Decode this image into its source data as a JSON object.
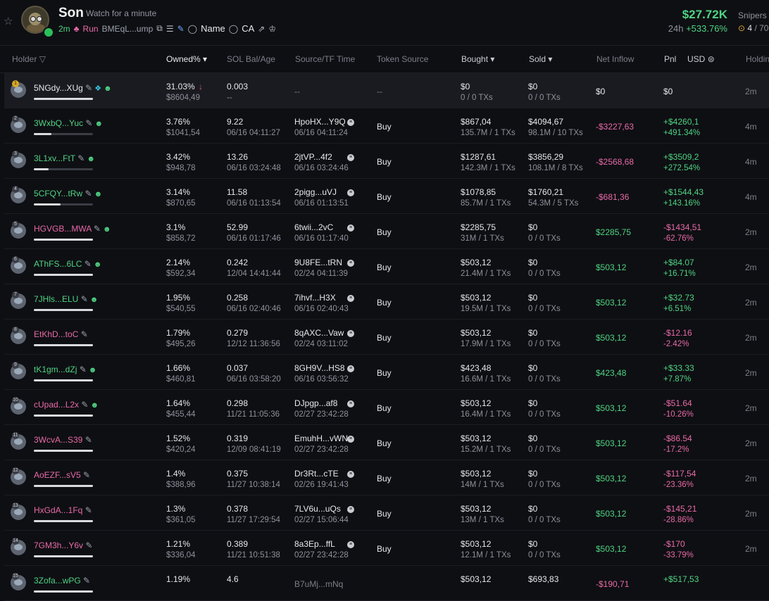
{
  "header": {
    "star_icon": "star-icon",
    "token_name": "Son",
    "token_subtitle": "Watch for a minute",
    "age": "2m",
    "platform": "Run",
    "contract_short": "BMEqL...ump",
    "search_name_label": "Name",
    "search_ca_label": "CA",
    "market_cap": "$27.72K",
    "change_period": "24h",
    "change_value": "+533.76%",
    "snipers_label": "Snipers",
    "snipers_value": "4",
    "snipers_total": "/ 70"
  },
  "columns": {
    "holder": "Holder",
    "owned": "Owned%",
    "sol_bal": "SOL Bal/Age",
    "source_tf": "Source/TF Time",
    "token_source": "Token Source",
    "bought": "Bought",
    "sold": "Sold",
    "net_inflow": "Net Inflow",
    "pnl": "Pnl",
    "usd": "USD",
    "holding": "Holdin"
  },
  "rows": [
    {
      "rank": "1",
      "addr": "5NGdy...XUg",
      "addr_color": "w",
      "bar": 1.0,
      "owned": "31.03%",
      "owned_usd": "$8604,49",
      "sol": "0.003",
      "sol_age": "--",
      "src": "--",
      "src_time": "",
      "token_source": "--",
      "bought": "$0",
      "bought_tx": "0 / 0 TXs",
      "sold": "$0",
      "sold_tx": "0 / 0 TXs",
      "inflow": "$0",
      "inflow_cls": "w",
      "pnl": "$0",
      "pnl_pct": "",
      "pnl_cls": "w",
      "holding": "2m"
    },
    {
      "rank": "2",
      "addr": "3WxbQ...Yuc",
      "addr_color": "g",
      "bar": 0.3,
      "owned": "3.76%",
      "owned_usd": "$1041,54",
      "sol": "9.22",
      "sol_age": "06/16 04:11:27",
      "src": "HpoHX...Y9Q",
      "src_time": "06/16 04:11:24",
      "token_source": "Buy",
      "bought": "$867,04",
      "bought_tx": "135.7M / 1 TXs",
      "sold": "$4094,67",
      "sold_tx": "98.1M / 10 TXs",
      "inflow": "-$3227,63",
      "inflow_cls": "neg",
      "pnl": "+$4260,1",
      "pnl_pct": "+491.34%",
      "pnl_cls": "pos",
      "holding": "4m"
    },
    {
      "rank": "3",
      "addr": "3L1xv...FtT",
      "addr_color": "g",
      "bar": 0.25,
      "owned": "3.42%",
      "owned_usd": "$948,78",
      "sol": "13.26",
      "sol_age": "06/16 03:24:48",
      "src": "2jtVP...4f2",
      "src_time": "06/16 03:24:46",
      "token_source": "Buy",
      "bought": "$1287,61",
      "bought_tx": "142.3M / 1 TXs",
      "sold": "$3856,29",
      "sold_tx": "108.1M / 8 TXs",
      "inflow": "-$2568,68",
      "inflow_cls": "neg",
      "pnl": "+$3509,2",
      "pnl_pct": "+272.54%",
      "pnl_cls": "pos",
      "holding": "4m"
    },
    {
      "rank": "4",
      "addr": "5CFQY...tRw",
      "addr_color": "g",
      "bar": 0.45,
      "owned": "3.14%",
      "owned_usd": "$870,65",
      "sol": "11.58",
      "sol_age": "06/16 01:13:54",
      "src": "2pigg...uVJ",
      "src_time": "06/16 01:13:51",
      "token_source": "Buy",
      "bought": "$1078,85",
      "bought_tx": "85.7M / 1 TXs",
      "sold": "$1760,21",
      "sold_tx": "54.3M / 5 TXs",
      "inflow": "-$681,36",
      "inflow_cls": "neg",
      "pnl": "+$1544,43",
      "pnl_pct": "+143.16%",
      "pnl_cls": "pos",
      "holding": "4m"
    },
    {
      "rank": "5",
      "addr": "HGVGB...MWA",
      "addr_color": "p",
      "bar": 1.0,
      "owned": "3.1%",
      "owned_usd": "$858,72",
      "sol": "52.99",
      "sol_age": "06/16 01:17:46",
      "src": "6twii...2vC",
      "src_time": "06/16 01:17:40",
      "token_source": "Buy",
      "bought": "$2285,75",
      "bought_tx": "31M / 1 TXs",
      "sold": "$0",
      "sold_tx": "0 / 0 TXs",
      "inflow": "$2285,75",
      "inflow_cls": "pos",
      "pnl": "-$1434,51",
      "pnl_pct": "-62.76%",
      "pnl_cls": "neg",
      "holding": "2m"
    },
    {
      "rank": "6",
      "addr": "AThFS...6LC",
      "addr_color": "g",
      "bar": 1.0,
      "owned": "2.14%",
      "owned_usd": "$592,34",
      "sol": "0.242",
      "sol_age": "12/04 14:41:44",
      "src": "9U8FE...tRN",
      "src_time": "02/24 04:11:39",
      "token_source": "Buy",
      "bought": "$503,12",
      "bought_tx": "21.4M / 1 TXs",
      "sold": "$0",
      "sold_tx": "0 / 0 TXs",
      "inflow": "$503,12",
      "inflow_cls": "pos",
      "pnl": "+$84.07",
      "pnl_pct": "+16.71%",
      "pnl_cls": "pos",
      "holding": "2m"
    },
    {
      "rank": "7",
      "addr": "7JHls...ELU",
      "addr_color": "g",
      "bar": 1.0,
      "owned": "1.95%",
      "owned_usd": "$540,55",
      "sol": "0.258",
      "sol_age": "06/16 02:40:46",
      "src": "7ihvf...H3X",
      "src_time": "06/16 02:40:43",
      "token_source": "Buy",
      "bought": "$503,12",
      "bought_tx": "19.5M / 1 TXs",
      "sold": "$0",
      "sold_tx": "0 / 0 TXs",
      "inflow": "$503,12",
      "inflow_cls": "pos",
      "pnl": "+$32.73",
      "pnl_pct": "+6.51%",
      "pnl_cls": "pos",
      "holding": "2m"
    },
    {
      "rank": "8",
      "addr": "EtKhD...toC",
      "addr_color": "p",
      "bar": 1.0,
      "owned": "1.79%",
      "owned_usd": "$495,26",
      "sol": "0.279",
      "sol_age": "12/12 11:36:56",
      "src": "8qAXC...Vaw",
      "src_time": "02/24 03:11:02",
      "token_source": "Buy",
      "bought": "$503,12",
      "bought_tx": "17.9M / 1 TXs",
      "sold": "$0",
      "sold_tx": "0 / 0 TXs",
      "inflow": "$503,12",
      "inflow_cls": "pos",
      "pnl": "-$12.16",
      "pnl_pct": "-2.42%",
      "pnl_cls": "neg",
      "holding": "2m"
    },
    {
      "rank": "9",
      "addr": "tK1gm...dZj",
      "addr_color": "g",
      "bar": 1.0,
      "owned": "1.66%",
      "owned_usd": "$460,81",
      "sol": "0.037",
      "sol_age": "06/16 03:58:20",
      "src": "8GH9V...HS8",
      "src_time": "06/16 03:56:32",
      "token_source": "Buy",
      "bought": "$423,48",
      "bought_tx": "16.6M / 1 TXs",
      "sold": "$0",
      "sold_tx": "0 / 0 TXs",
      "inflow": "$423,48",
      "inflow_cls": "pos",
      "pnl": "+$33.33",
      "pnl_pct": "+7.87%",
      "pnl_cls": "pos",
      "holding": "2m"
    },
    {
      "rank": "10",
      "addr": "cUpad...L2x",
      "addr_color": "p",
      "bar": 1.0,
      "owned": "1.64%",
      "owned_usd": "$455,44",
      "sol": "0.298",
      "sol_age": "11/21 11:05:36",
      "src": "DJpgp...af8",
      "src_time": "02/27 23:42:28",
      "token_source": "Buy",
      "bought": "$503,12",
      "bought_tx": "16.4M / 1 TXs",
      "sold": "$0",
      "sold_tx": "0 / 0 TXs",
      "inflow": "$503,12",
      "inflow_cls": "pos",
      "pnl": "-$51.64",
      "pnl_pct": "-10.26%",
      "pnl_cls": "neg",
      "holding": "2m"
    },
    {
      "rank": "11",
      "addr": "3WcvA...S39",
      "addr_color": "p",
      "bar": 1.0,
      "owned": "1.52%",
      "owned_usd": "$420,24",
      "sol": "0.319",
      "sol_age": "12/09 08:41:19",
      "src": "EmuhH...vWN",
      "src_time": "02/27 23:42:28",
      "token_source": "Buy",
      "bought": "$503,12",
      "bought_tx": "15.2M / 1 TXs",
      "sold": "$0",
      "sold_tx": "0 / 0 TXs",
      "inflow": "$503,12",
      "inflow_cls": "pos",
      "pnl": "-$86.54",
      "pnl_pct": "-17.2%",
      "pnl_cls": "neg",
      "holding": "2m"
    },
    {
      "rank": "12",
      "addr": "AoEZF...sV5",
      "addr_color": "p",
      "bar": 1.0,
      "owned": "1.4%",
      "owned_usd": "$388,96",
      "sol": "0.375",
      "sol_age": "11/27 10:38:14",
      "src": "Dr3Rt...cTE",
      "src_time": "02/26 19:41:43",
      "token_source": "Buy",
      "bought": "$503,12",
      "bought_tx": "14M / 1 TXs",
      "sold": "$0",
      "sold_tx": "0 / 0 TXs",
      "inflow": "$503,12",
      "inflow_cls": "pos",
      "pnl": "-$117,54",
      "pnl_pct": "-23.36%",
      "pnl_cls": "neg",
      "holding": "2m"
    },
    {
      "rank": "13",
      "addr": "HxGdA...1Fq",
      "addr_color": "p",
      "bar": 1.0,
      "owned": "1.3%",
      "owned_usd": "$361,05",
      "sol": "0.378",
      "sol_age": "11/27 17:29:54",
      "src": "7LV6u...uQs",
      "src_time": "02/27 15:06:44",
      "token_source": "Buy",
      "bought": "$503,12",
      "bought_tx": "13M / 1 TXs",
      "sold": "$0",
      "sold_tx": "0 / 0 TXs",
      "inflow": "$503,12",
      "inflow_cls": "pos",
      "pnl": "-$145,21",
      "pnl_pct": "-28.86%",
      "pnl_cls": "neg",
      "holding": "2m"
    },
    {
      "rank": "14",
      "addr": "7GM3h...Y6v",
      "addr_color": "p",
      "bar": 1.0,
      "owned": "1.21%",
      "owned_usd": "$336,04",
      "sol": "0.389",
      "sol_age": "11/21 10:51:38",
      "src": "8a3Ep...ffL",
      "src_time": "02/27 23:42:28",
      "token_source": "Buy",
      "bought": "$503,12",
      "bought_tx": "12.1M / 1 TXs",
      "sold": "$0",
      "sold_tx": "0 / 0 TXs",
      "inflow": "$503,12",
      "inflow_cls": "pos",
      "pnl": "-$170",
      "pnl_pct": "-33.79%",
      "pnl_cls": "neg",
      "holding": "2m"
    },
    {
      "rank": "15",
      "addr": "3Zofa...wPG",
      "addr_color": "g",
      "bar": 1.0,
      "owned": "1.19%",
      "owned_usd": "",
      "sol": "4.6",
      "sol_age": "",
      "src": "B7uMj...mNq",
      "src_time": "",
      "token_source": "",
      "bought": "$503,12",
      "bought_tx": "",
      "sold": "$693,83",
      "sold_tx": "",
      "inflow": "-$190,71",
      "inflow_cls": "neg",
      "pnl": "+$517,53",
      "pnl_pct": "",
      "pnl_cls": "pos",
      "holding": ""
    }
  ]
}
